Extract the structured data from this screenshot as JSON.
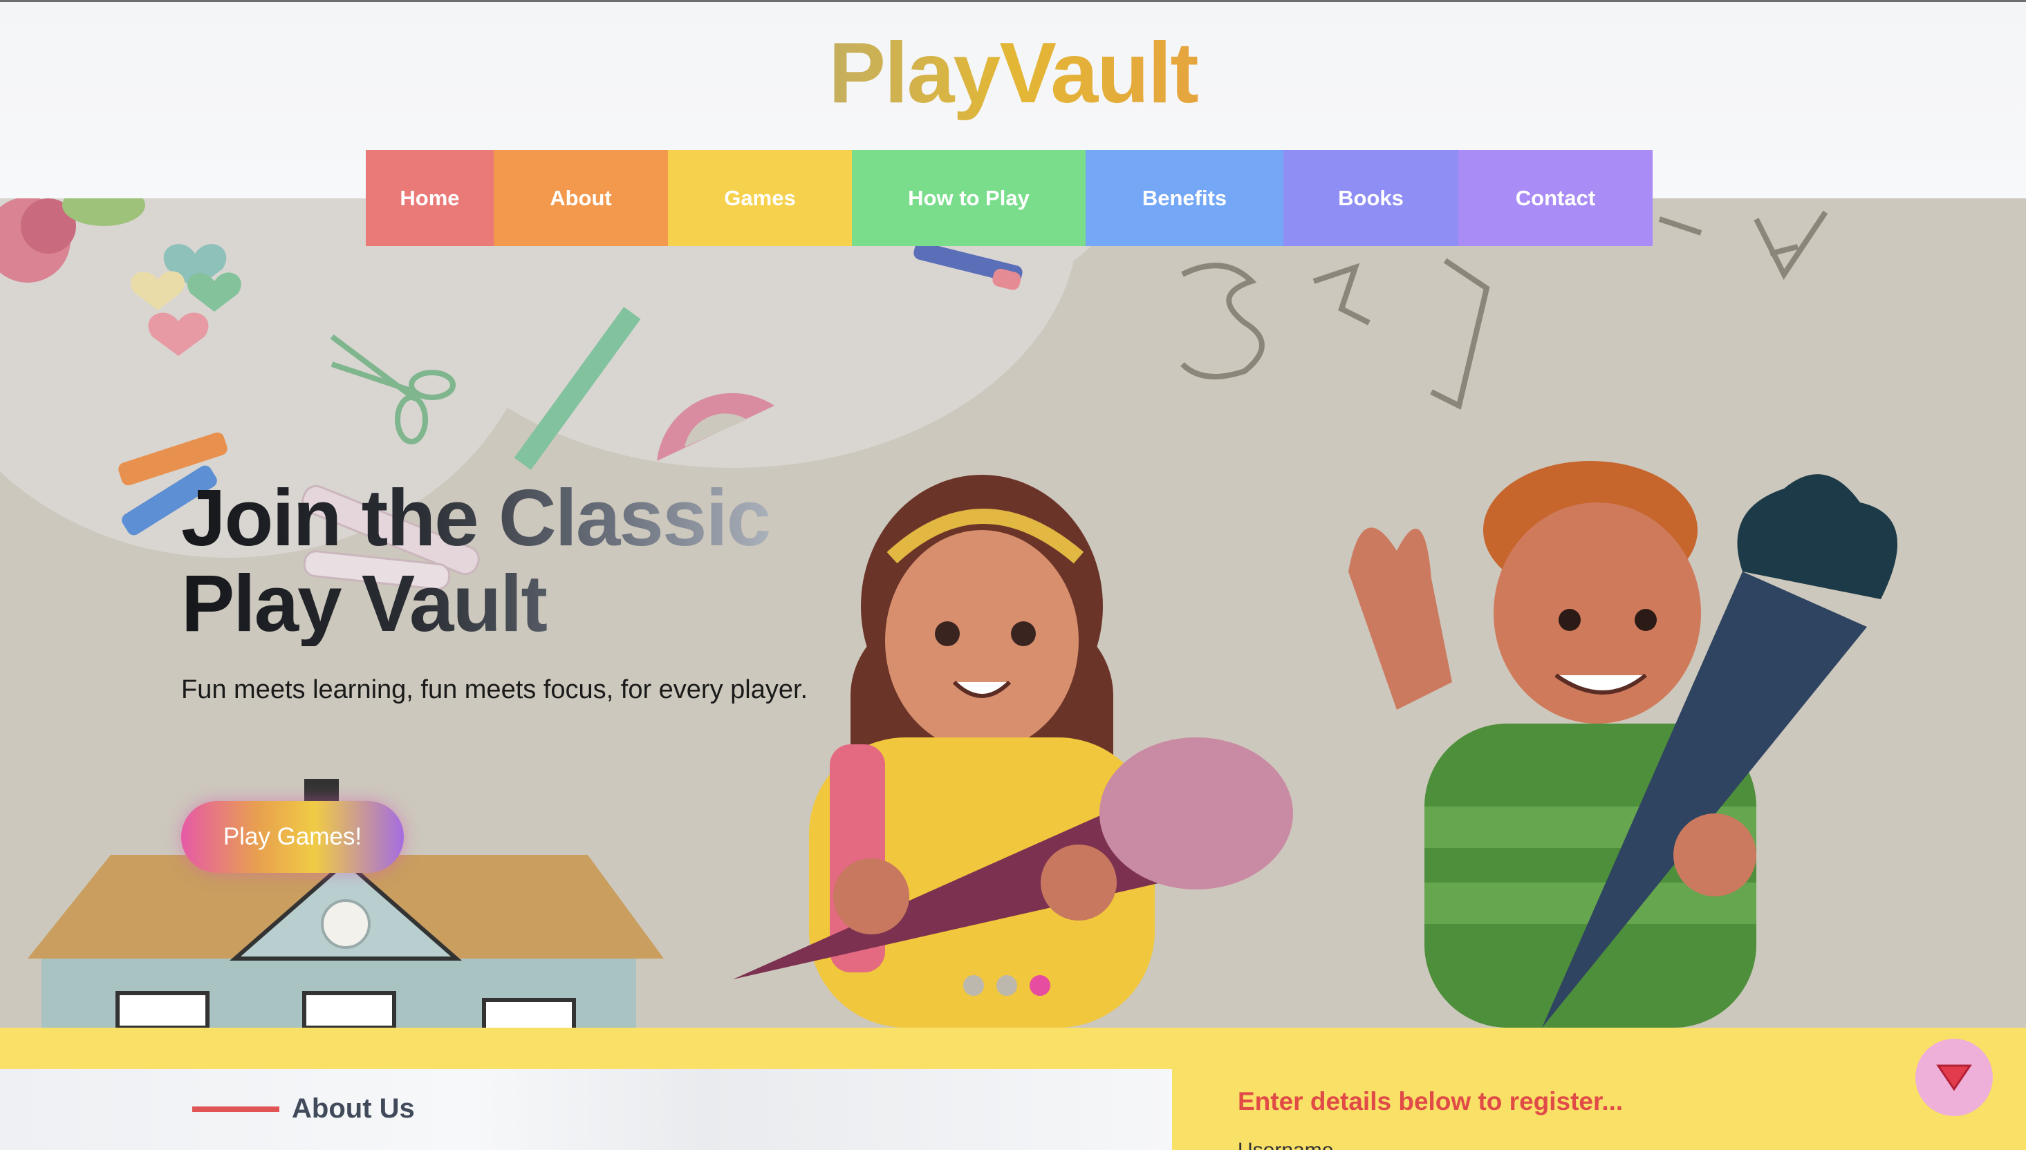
{
  "header": {
    "logo": "PlayVault"
  },
  "nav": {
    "items": [
      {
        "label": "Home",
        "color": "#ea7a78"
      },
      {
        "label": "About",
        "color": "#f3994e"
      },
      {
        "label": "Games",
        "color": "#f5d14d"
      },
      {
        "label": "How to Play",
        "color": "#79dd8b"
      },
      {
        "label": "Benefits",
        "color": "#74a7f5"
      },
      {
        "label": "Books",
        "color": "#8f8ef4"
      },
      {
        "label": "Contact",
        "color": "#a98cf6"
      }
    ]
  },
  "hero": {
    "title_line1": "Join the Classic",
    "title_line2": "Play Vault",
    "subtitle": "Fun meets learning, fun meets focus, for every player.",
    "cta_label": "Play Games!",
    "slides": {
      "count": 3,
      "active_index": 2
    }
  },
  "about": {
    "heading": "About Us"
  },
  "register": {
    "prompt": "Enter details below to register...",
    "username_label": "Username"
  },
  "scroll_button": {
    "icon": "triangle-down-icon",
    "color": "#e33b4e"
  },
  "colors": {
    "band": "#f9e066",
    "accent_red": "#e04b48",
    "active_dot": "#e64da0"
  }
}
